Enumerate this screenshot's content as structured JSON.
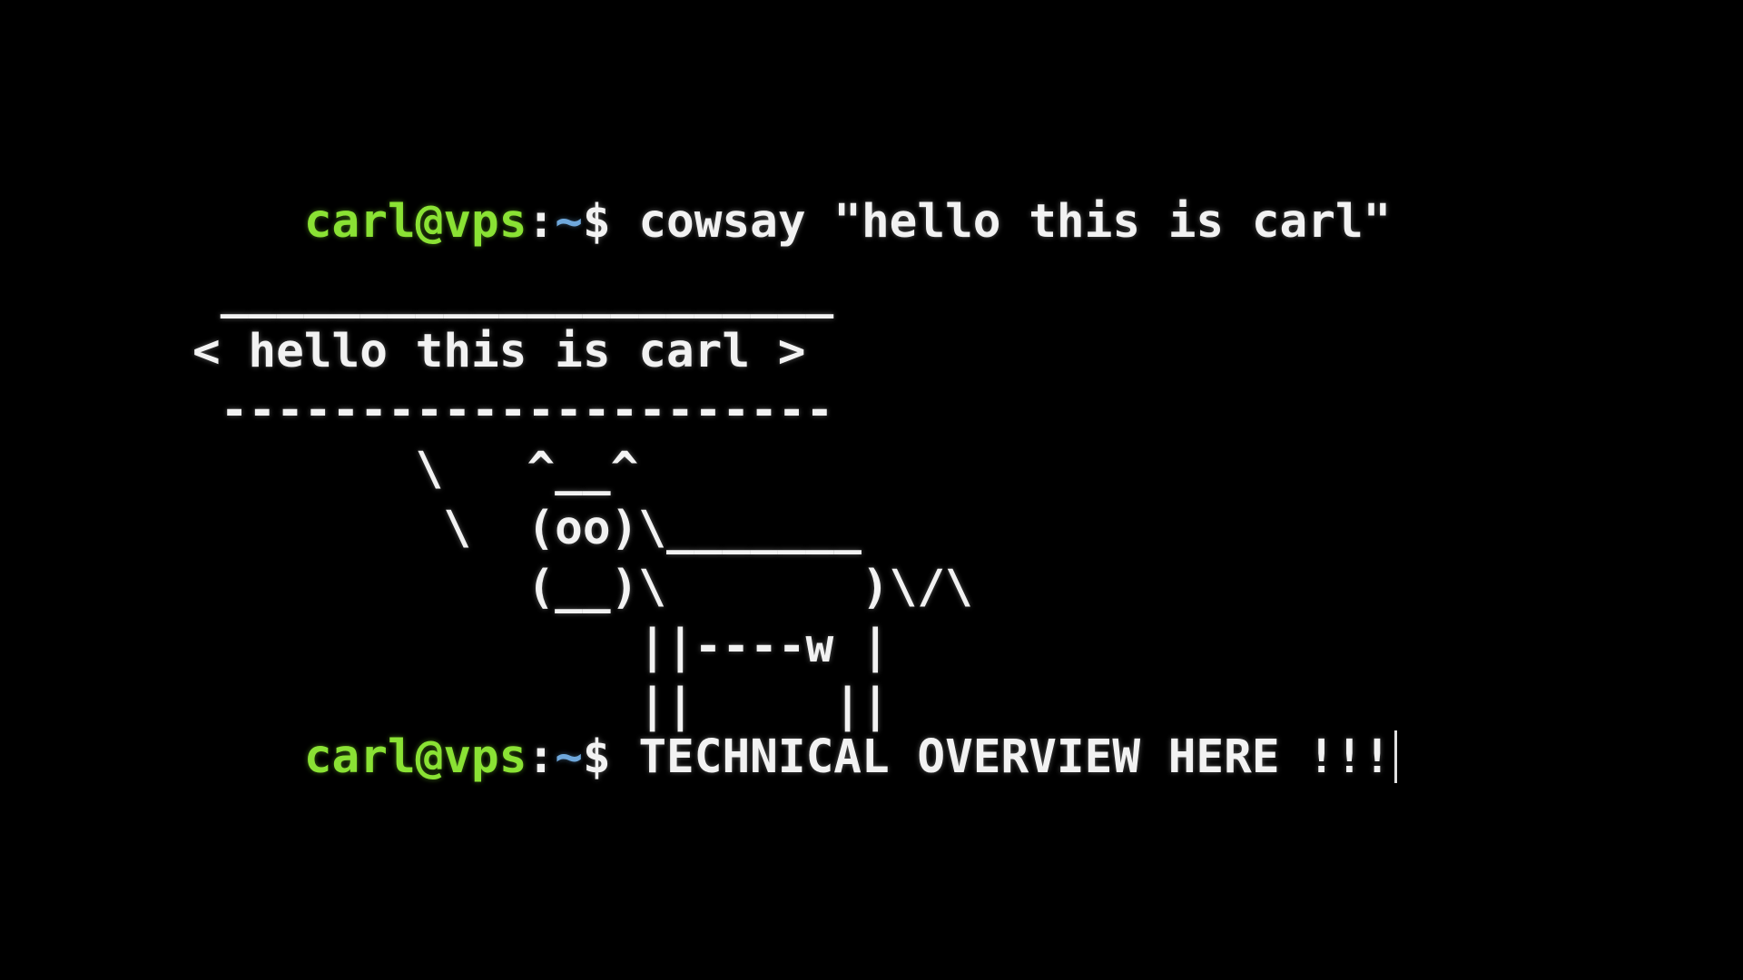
{
  "terminal": {
    "prompt_user_host": "carl@vps",
    "prompt_colon": ":",
    "prompt_path": "~",
    "prompt_symbol": "$",
    "command_1": "cowsay \"hello this is carl\"",
    "cowsay_output": [
      " ______________________",
      "< hello this is carl >",
      " ----------------------",
      "        \\   ^__^",
      "         \\  (oo)\\_______",
      "            (__)\\       )\\/\\",
      "                ||----w |",
      "                ||     ||"
    ],
    "command_2": "TECHNICAL OVERVIEW HERE !!!",
    "colors": {
      "background": "#000000",
      "user_host": "#8ae234",
      "path": "#6fa8dc",
      "text": "#f2f2f2"
    }
  }
}
